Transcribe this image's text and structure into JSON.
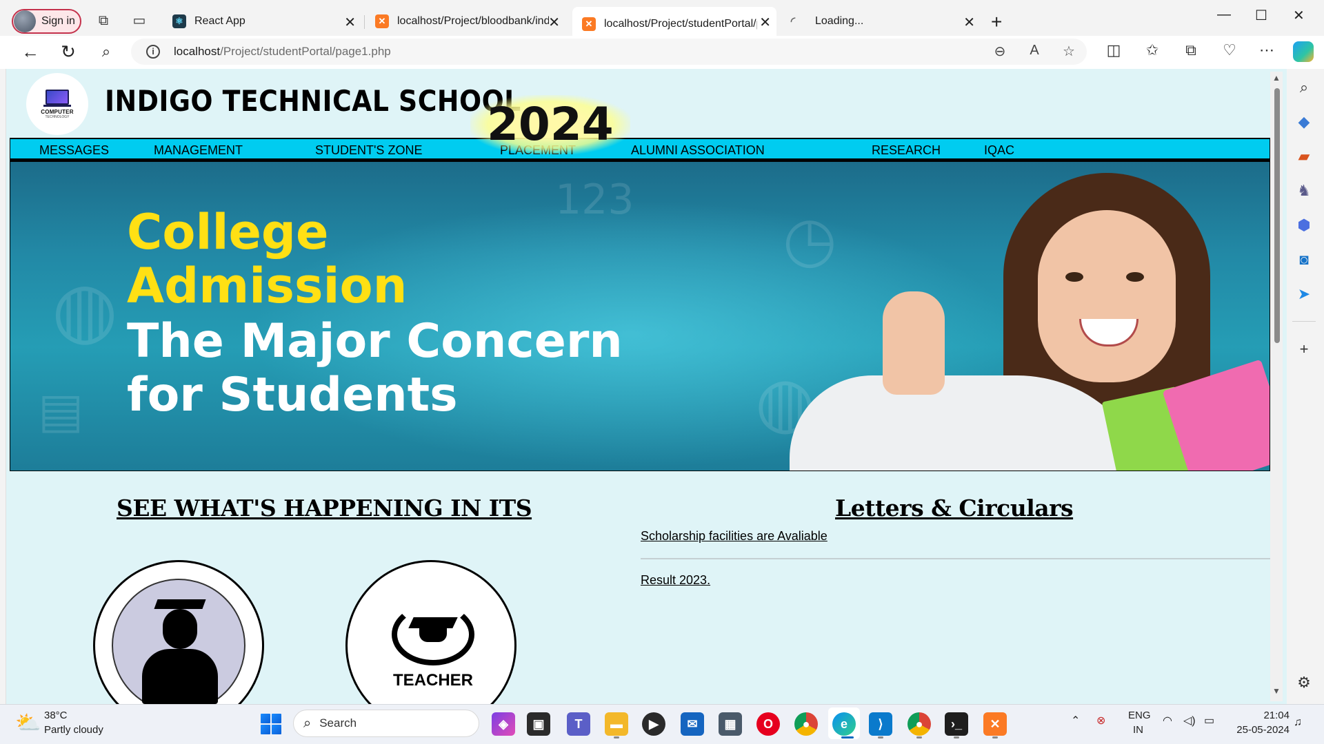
{
  "browser": {
    "signin_label": "Sign in",
    "tabs": [
      {
        "title": "React App",
        "favicon": "react-icon"
      },
      {
        "title": "localhost/Project/bloodbank/ind",
        "favicon": "xampp-icon"
      },
      {
        "title": "localhost/Project/studentPortal/p",
        "favicon": "xampp-icon"
      },
      {
        "title": "Loading...",
        "favicon": "loading-spinner-icon"
      }
    ],
    "url_host": "localhost",
    "url_path": "/Project/studentPortal/page1.php"
  },
  "page": {
    "school_name": "INDIGO TECHNICAL SCHOOL",
    "logo_text": "COMPUTER",
    "logo_subtext": "TECHNOLOGY",
    "menu": [
      "MESSAGES",
      "MANAGEMENT",
      "STUDENT'S ZONE",
      "PLACEMENT",
      "ALUMNI ASSOCIATION",
      "RESEARCH",
      "IQAC"
    ],
    "banner": {
      "line1": "College",
      "line2": "Admission",
      "year": "2024",
      "line3": "The Major Concern",
      "line4": "for Students"
    },
    "happening_title": "SEE WHAT'S HAPPENING IN ITS",
    "letters_title": "Letters & Circulars",
    "news": [
      "Scholarship facilities are Avaliable",
      "Result 2023."
    ],
    "cards": [
      {
        "label": "STUDENT"
      },
      {
        "label": "TEACHER"
      }
    ]
  },
  "taskbar": {
    "weather_temp": "38°C",
    "weather_condition": "Partly cloudy",
    "search_label": "Search",
    "lang_line1": "ENG",
    "lang_line2": "IN",
    "time": "21:04",
    "date": "25-05-2024"
  }
}
